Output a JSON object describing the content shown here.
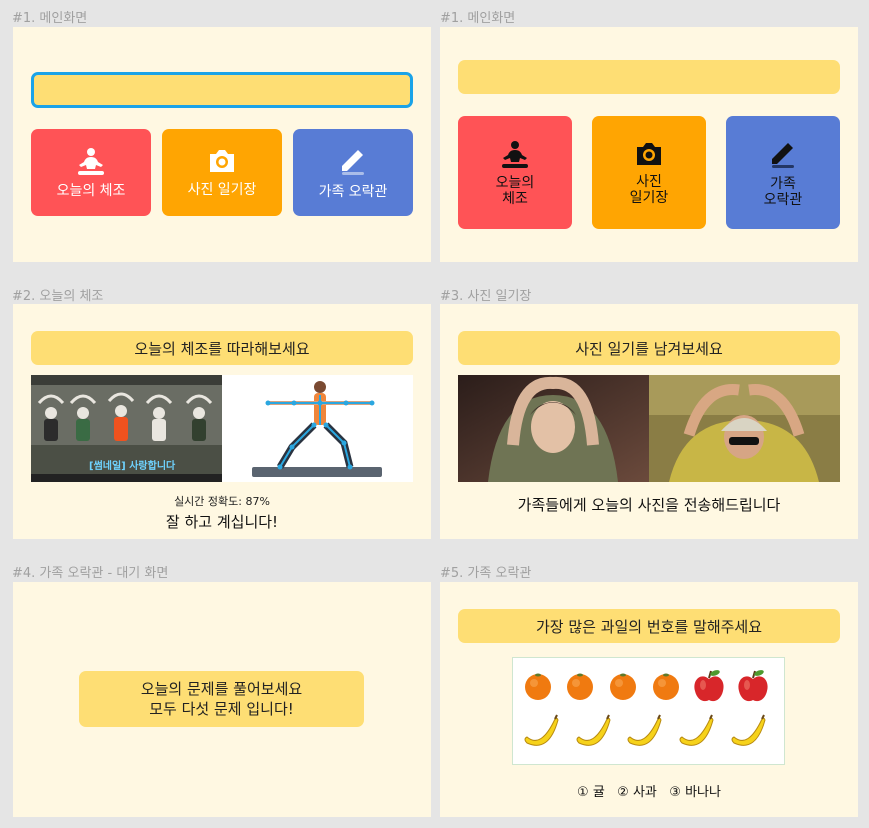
{
  "screens": {
    "s1a": {
      "label": "#1. 메인화면"
    },
    "s1b": {
      "label": "#1. 메인화면"
    },
    "s2": {
      "label": "#2. 오늘의 체조",
      "banner": "오늘의 체조를 따라해보세요",
      "video_caption": "[썸네일] 사랑합니다",
      "accuracy": "실시간 정확도: 87%",
      "praise": "잘 하고 계십니다!"
    },
    "s3": {
      "label": "#3. 사진 일기장",
      "banner": "사진 일기를 남겨보세요",
      "caption": "가족들에게 오늘의 사진을 전송해드립니다"
    },
    "s4": {
      "label": "#4. 가족 오락관 - 대기 화면",
      "msg_line1": "오늘의 문제를 풀어보세요",
      "msg_line2": "모두 다섯 문제 입니다!"
    },
    "s5": {
      "label": "#5. 가족 오락관",
      "banner": "가장 많은 과일의 번호를 말해주세요",
      "options": "① 귤   ② 사과   ③ 바나나"
    }
  },
  "menu": {
    "exercise": "오늘의 체조",
    "photo": "사진 일기장",
    "family": "가족 오락관",
    "exercise_stacked": "오늘의\n체조",
    "photo_stacked": "사진\n일기장",
    "family_stacked": "가족\n오락관"
  },
  "colors": {
    "panel": "#fff8e2",
    "banner": "#fede74",
    "red": "#ff5356",
    "orange": "#ffa502",
    "blue": "#587cd5",
    "focus_border": "#1aa3e8"
  },
  "icons": {
    "exercise": "meditation-icon",
    "photo": "camera-icon",
    "family": "pencil-icon"
  }
}
